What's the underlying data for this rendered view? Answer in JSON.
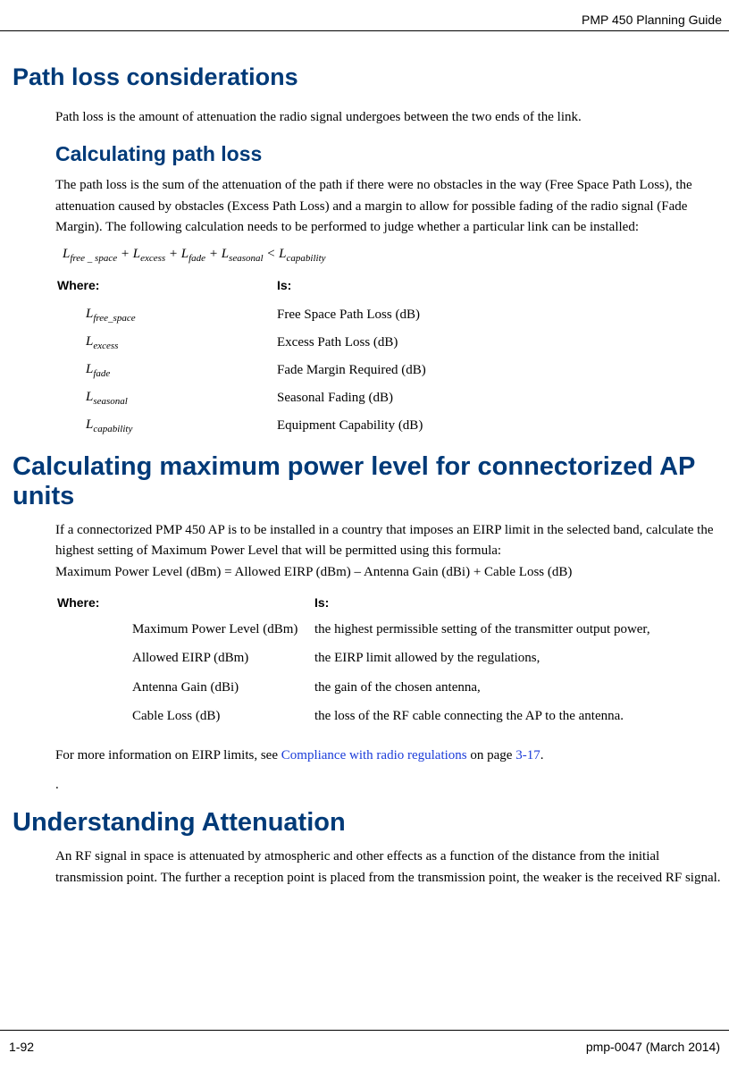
{
  "header": {
    "guide_title": "PMP 450 Planning Guide"
  },
  "h1": "Path loss considerations",
  "p1": "Path loss is the amount of attenuation the radio signal undergoes between the two ends of the link.",
  "h2_calc": "Calculating path loss",
  "p2": "The path loss is the sum of the attenuation of the path if there were no obstacles in the way (Free Space Path Loss), the attenuation caused by obstacles (Excess Path Loss) and a margin to allow for possible fading of the radio signal (Fade Margin). The following calculation needs to be performed to judge whether a particular link can be installed:",
  "tbl1": {
    "head_where": "Where:",
    "head_is": "Is:",
    "rows": [
      {
        "sub": "free_space",
        "is": "Free Space Path Loss (dB)"
      },
      {
        "sub": "excess",
        "is": "Excess Path Loss (dB)"
      },
      {
        "sub": "fade",
        "is": "Fade Margin Required (dB)"
      },
      {
        "sub": "seasonal",
        "is": "Seasonal Fading (dB)"
      },
      {
        "sub": "capability",
        "is": "Equipment Capability (dB)"
      }
    ]
  },
  "h1_calcmax": "Calculating maximum power level for connectorized AP units",
  "p3a": "If a connectorized PMP 450 AP is to be installed in a country that imposes an EIRP limit in the selected band, calculate the highest setting of Maximum Power Level that will be permitted using this formula:",
  "p3b": "Maximum Power Level (dBm) = Allowed EIRP (dBm) – Antenna Gain (dBi) + Cable Loss (dB)",
  "tbl2": {
    "head_where": "Where:",
    "head_is": "Is:",
    "rows": [
      {
        "param": "Maximum Power Level (dBm)",
        "is": "the highest permissible setting of the transmitter output power,"
      },
      {
        "param": "Allowed EIRP (dBm)",
        "is": "the EIRP limit allowed by the regulations,"
      },
      {
        "param": "Antenna Gain (dBi)",
        "is": "the gain of the chosen antenna,"
      },
      {
        "param": "Cable Loss (dB)",
        "is": "the loss of the RF cable connecting the AP to the antenna."
      }
    ]
  },
  "p4_pre": "For more information on EIRP limits, see ",
  "p4_link": "Compliance with radio regulations",
  "p4_mid": " on page ",
  "p4_page": "3-17",
  "p4_post": ".",
  "p5_dot": ".",
  "h1_att": "Understanding Attenuation",
  "p6": "An RF signal in space is attenuated by atmospheric and other effects as a function of the distance from the initial transmission point. The further a reception point is placed from the transmission point, the weaker is the received RF signal.",
  "footer": {
    "left": "1-92",
    "right": "pmp-0047 (March 2014)"
  }
}
